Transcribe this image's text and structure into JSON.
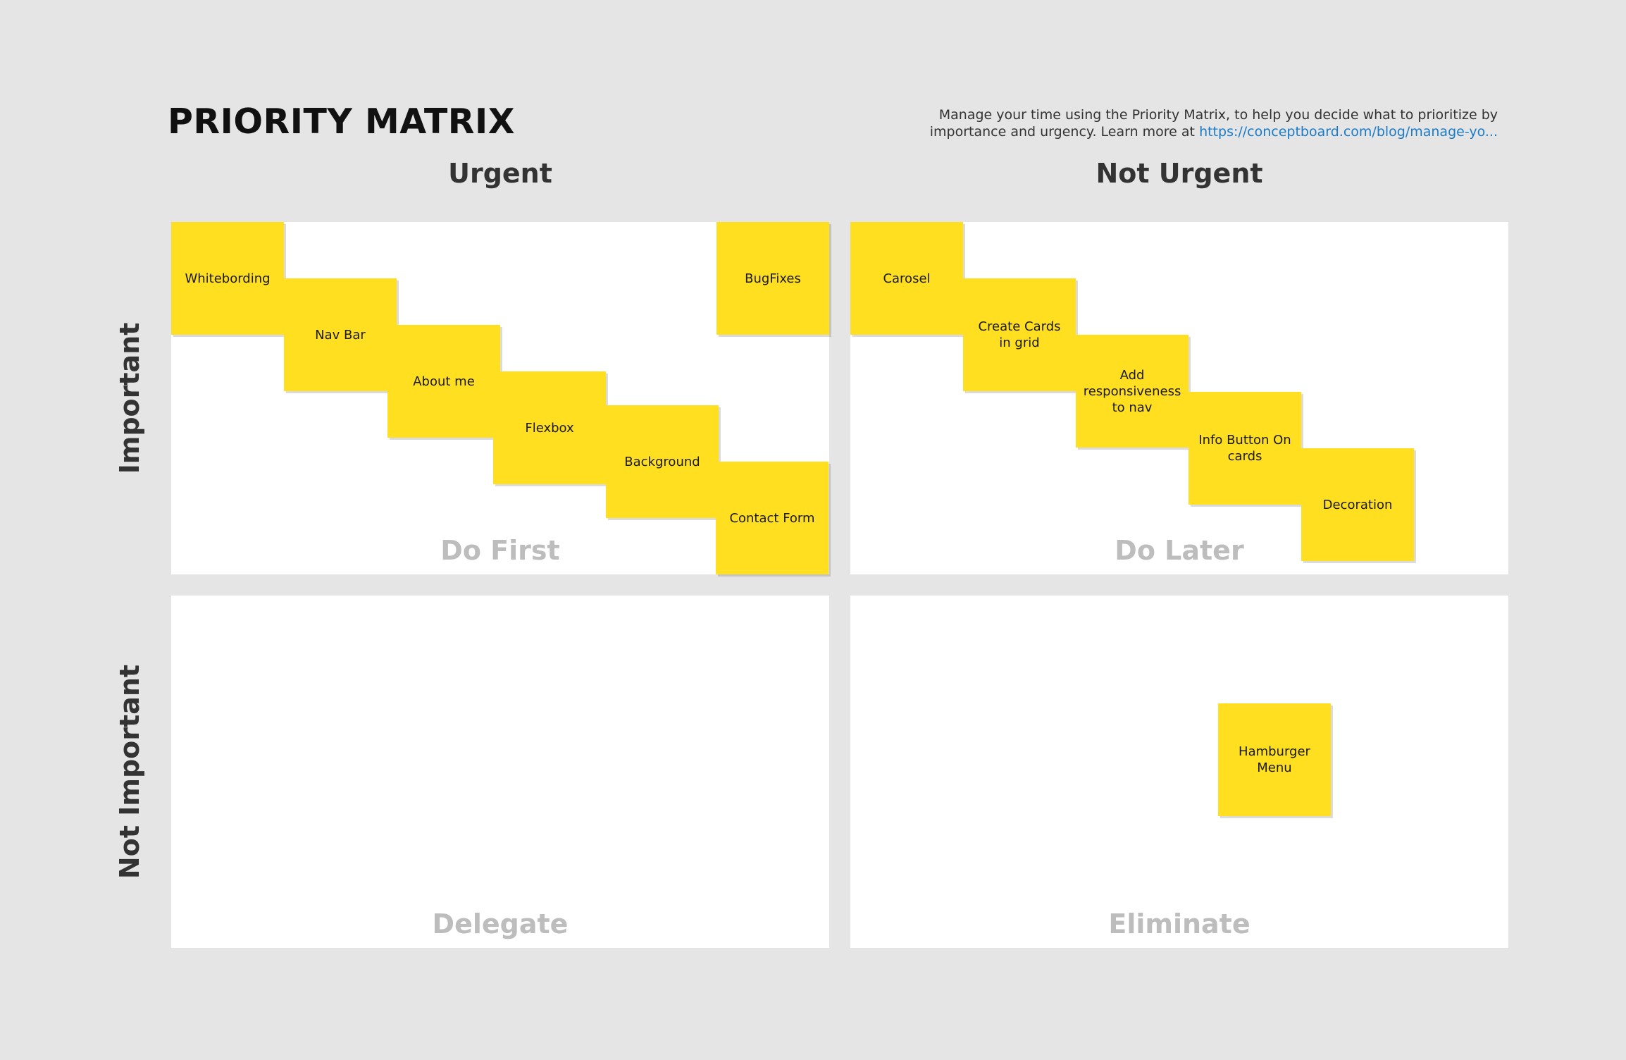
{
  "header": {
    "title": "PRIORITY MATRIX",
    "description": "Manage your time using the Priority Matrix, to help you decide what to prioritize by importance and urgency. Learn more at ",
    "link_text": "https://conceptboard.com/blog/manage-yo..."
  },
  "axes": {
    "col_urgent": "Urgent",
    "col_not_urgent": "Not Urgent",
    "row_important": "Important",
    "row_not_important": "Not Important"
  },
  "quadrants": {
    "do_first": {
      "label": "Do First",
      "notes": [
        "Whitebording",
        "Nav Bar",
        "About me",
        "Flexbox",
        "Background",
        "BugFixes",
        "Contact Form"
      ]
    },
    "do_later": {
      "label": "Do Later",
      "notes": [
        "Carosel",
        "Create Cards in grid",
        "Add responsiveness to nav",
        "Info Button On cards",
        "Decoration"
      ]
    },
    "delegate": {
      "label": "Delegate",
      "notes": []
    },
    "eliminate": {
      "label": "Eliminate",
      "notes": [
        "Hamburger Menu"
      ]
    }
  },
  "colors": {
    "sticky_note": "#ffdf1f",
    "background": "#e5e5e5",
    "quadrant": "#ffffff",
    "link": "#1a7cc9"
  }
}
